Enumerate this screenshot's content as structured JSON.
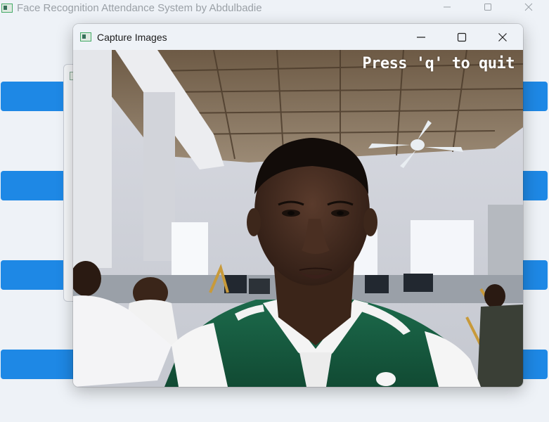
{
  "main_window": {
    "title": "Face Recognition Attendance System by Abdulbadie",
    "controls": [
      "minimize-icon",
      "maximize-icon",
      "close-icon"
    ]
  },
  "capture_window": {
    "title": "Capture Images",
    "controls": [
      "minimize-icon",
      "maximize-icon",
      "close-icon"
    ],
    "overlay_text": "Press 'q' to quit",
    "content": "camera-frame"
  },
  "colors": {
    "accent_button": "#1e88e5",
    "window_bg": "#eef2f7",
    "overlay_text": "#ffffff"
  }
}
